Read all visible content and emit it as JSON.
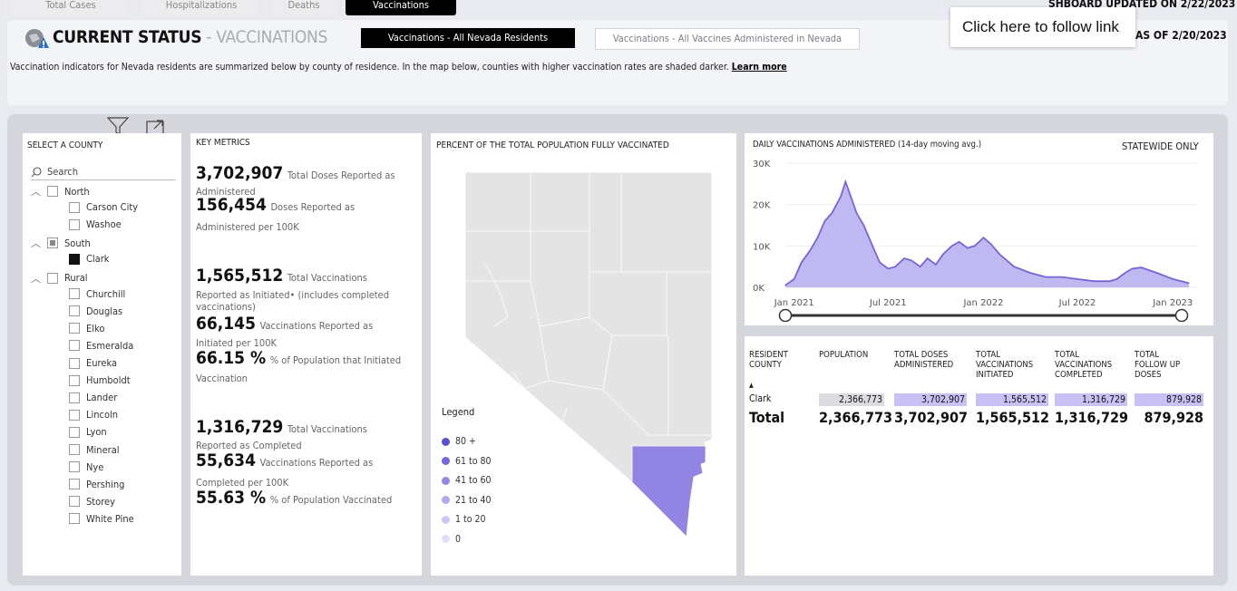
{
  "tabs": [
    {
      "label": "Total Cases",
      "active": false
    },
    {
      "label": "Hospitalizations",
      "active": false
    },
    {
      "label": "Deaths",
      "active": false
    },
    {
      "label": "Vaccinations",
      "active": true
    }
  ],
  "header": {
    "title_main": "CURRENT STATUS",
    "title_sep": " - ",
    "title_sub": "VACCINATIONS",
    "btn_residents": "Vaccinations - All Nevada Residents",
    "btn_all": "Vaccinations - All Vaccines Administered in Nevada",
    "description": "Vaccination indicators for Nevada residents are summarized below by county of residence.  In the map below, counties with higher vaccination rates are shaded darker.",
    "learn_more": "Learn more",
    "updated": "SHBOARD UPDATED ON 2/22/2023",
    "tooltip": "Click here to follow link",
    "as_of": "AS OF 2/20/2023"
  },
  "slicer": {
    "title": "SELECT A COUNTY",
    "search_placeholder": "Search",
    "groups": [
      {
        "label": "North",
        "state": "unchecked",
        "items": [
          {
            "label": "Carson City",
            "checked": false
          },
          {
            "label": "Washoe",
            "checked": false
          }
        ]
      },
      {
        "label": "South",
        "state": "partial",
        "items": [
          {
            "label": "Clark",
            "checked": true
          }
        ]
      },
      {
        "label": "Rural",
        "state": "unchecked",
        "items": [
          {
            "label": "Churchill",
            "checked": false
          },
          {
            "label": "Douglas",
            "checked": false
          },
          {
            "label": "Elko",
            "checked": false
          },
          {
            "label": "Esmeralda",
            "checked": false
          },
          {
            "label": "Eureka",
            "checked": false
          },
          {
            "label": "Humboldt",
            "checked": false
          },
          {
            "label": "Lander",
            "checked": false
          },
          {
            "label": "Lincoln",
            "checked": false
          },
          {
            "label": "Lyon",
            "checked": false
          },
          {
            "label": "Mineral",
            "checked": false
          },
          {
            "label": "Nye",
            "checked": false
          },
          {
            "label": "Pershing",
            "checked": false
          },
          {
            "label": "Storey",
            "checked": false
          },
          {
            "label": "White Pine",
            "checked": false
          }
        ]
      }
    ]
  },
  "metrics": {
    "title": "KEY METRICS",
    "total_doses": {
      "value": "3,702,907",
      "label": "Total Doses Reported as",
      "label2": "Administered"
    },
    "doses_per_100k": {
      "value": "156,454",
      "label": "Doses Reported as",
      "label2": "Administered per 100K"
    },
    "initiated": {
      "value": "1,565,512",
      "label": "Total Vaccinations",
      "label2": "Reported as Initiated• (includes completed",
      "label3": "vaccinations)"
    },
    "initiated_per_100k": {
      "value": "66,145",
      "label": "Vaccinations Reported as",
      "label2": "Initiated per 100K"
    },
    "initiated_pct": {
      "value": "66.15 %",
      "label": "% of Population that Initiated",
      "label2": "Vaccination"
    },
    "completed": {
      "value": "1,316,729",
      "label": "Total Vaccinations",
      "label2": "Reported as Completed"
    },
    "completed_per_100k": {
      "value": "55,634",
      "label": "Vaccinations Reported as",
      "label2": "Completed per 100K"
    },
    "completed_pct": {
      "value": "55.63 %",
      "label": "% of Population Vaccinated"
    }
  },
  "map": {
    "title": "PERCENT OF THE TOTAL POPULATION FULLY VACCINATED",
    "legend_title": "Legend",
    "legend": [
      {
        "label": "80 +",
        "color": "#5a4fcf"
      },
      {
        "label": "61 to 80",
        "color": "#7467d9"
      },
      {
        "label": "41 to 60",
        "color": "#9588e3"
      },
      {
        "label": "21 to 40",
        "color": "#b2a8eb"
      },
      {
        "label": "1 to 20",
        "color": "#cdc6f3"
      },
      {
        "label": "0",
        "color": "#e2defa"
      }
    ],
    "highlight_color": "#9184e2",
    "base_color": "#e4e4e4"
  },
  "line_chart": {
    "title": "DAILY VACCINATIONS ADMINISTERED (14-day moving avg.)",
    "subtitle": "STATEWIDE ONLY",
    "color": "#8a7ee0",
    "fill": "#c0b8f0"
  },
  "chart_data": {
    "type": "area",
    "title": "DAILY VACCINATIONS ADMINISTERED (14-day moving avg.)",
    "y_ticks": [
      "30K",
      "20K",
      "10K",
      "0K"
    ],
    "x_ticks": [
      "Jan 2021",
      "Jul 2021",
      "Jan 2022",
      "Jul 2022",
      "Jan 2023"
    ],
    "ylim": [
      0,
      30000
    ],
    "x": [
      "2020-12-15",
      "2021-01-01",
      "2021-01-15",
      "2021-02-01",
      "2021-02-15",
      "2021-03-01",
      "2021-03-15",
      "2021-04-01",
      "2021-04-10",
      "2021-04-20",
      "2021-05-01",
      "2021-05-15",
      "2021-06-01",
      "2021-06-15",
      "2021-07-01",
      "2021-07-15",
      "2021-08-01",
      "2021-08-15",
      "2021-09-01",
      "2021-09-15",
      "2021-10-01",
      "2021-10-15",
      "2021-11-01",
      "2021-11-15",
      "2021-12-01",
      "2021-12-15",
      "2022-01-01",
      "2022-01-15",
      "2022-02-01",
      "2022-03-01",
      "2022-04-01",
      "2022-05-01",
      "2022-06-01",
      "2022-07-01",
      "2022-08-01",
      "2022-09-01",
      "2022-09-15",
      "2022-10-01",
      "2022-10-15",
      "2022-11-01",
      "2022-12-01",
      "2023-01-01",
      "2023-02-01"
    ],
    "values": [
      500,
      2000,
      6000,
      9000,
      12000,
      16000,
      18000,
      22000,
      25500,
      22000,
      18000,
      15000,
      10000,
      6000,
      4500,
      5000,
      7000,
      6500,
      5000,
      7000,
      5500,
      8000,
      10000,
      11000,
      9500,
      10000,
      12000,
      10500,
      8000,
      5000,
      3500,
      2500,
      2500,
      2000,
      1500,
      1500,
      2000,
      3500,
      4500,
      4800,
      3500,
      2000,
      1000
    ]
  },
  "table": {
    "columns": [
      {
        "label": "RESIDENT\nCOUNTY"
      },
      {
        "label": "POPULATION"
      },
      {
        "label": "TOTAL DOSES\nADMINISTERED"
      },
      {
        "label": "TOTAL\nVACCINATIONS\nINITIATED"
      },
      {
        "label": "TOTAL\nVACCINATIONS\nCOMPLETED"
      },
      {
        "label": "TOTAL\nFOLLOW UP\nDOSES"
      }
    ],
    "row": {
      "county": "Clark",
      "population": "2,366,773",
      "doses": "3,702,907",
      "initiated": "1,565,512",
      "completed": "1,316,729",
      "followup": "879,928"
    },
    "total": {
      "label": "Total",
      "population": "2,366,773",
      "doses": "3,702,907",
      "initiated": "1,565,512",
      "completed": "1,316,729",
      "followup": "879,928"
    }
  }
}
